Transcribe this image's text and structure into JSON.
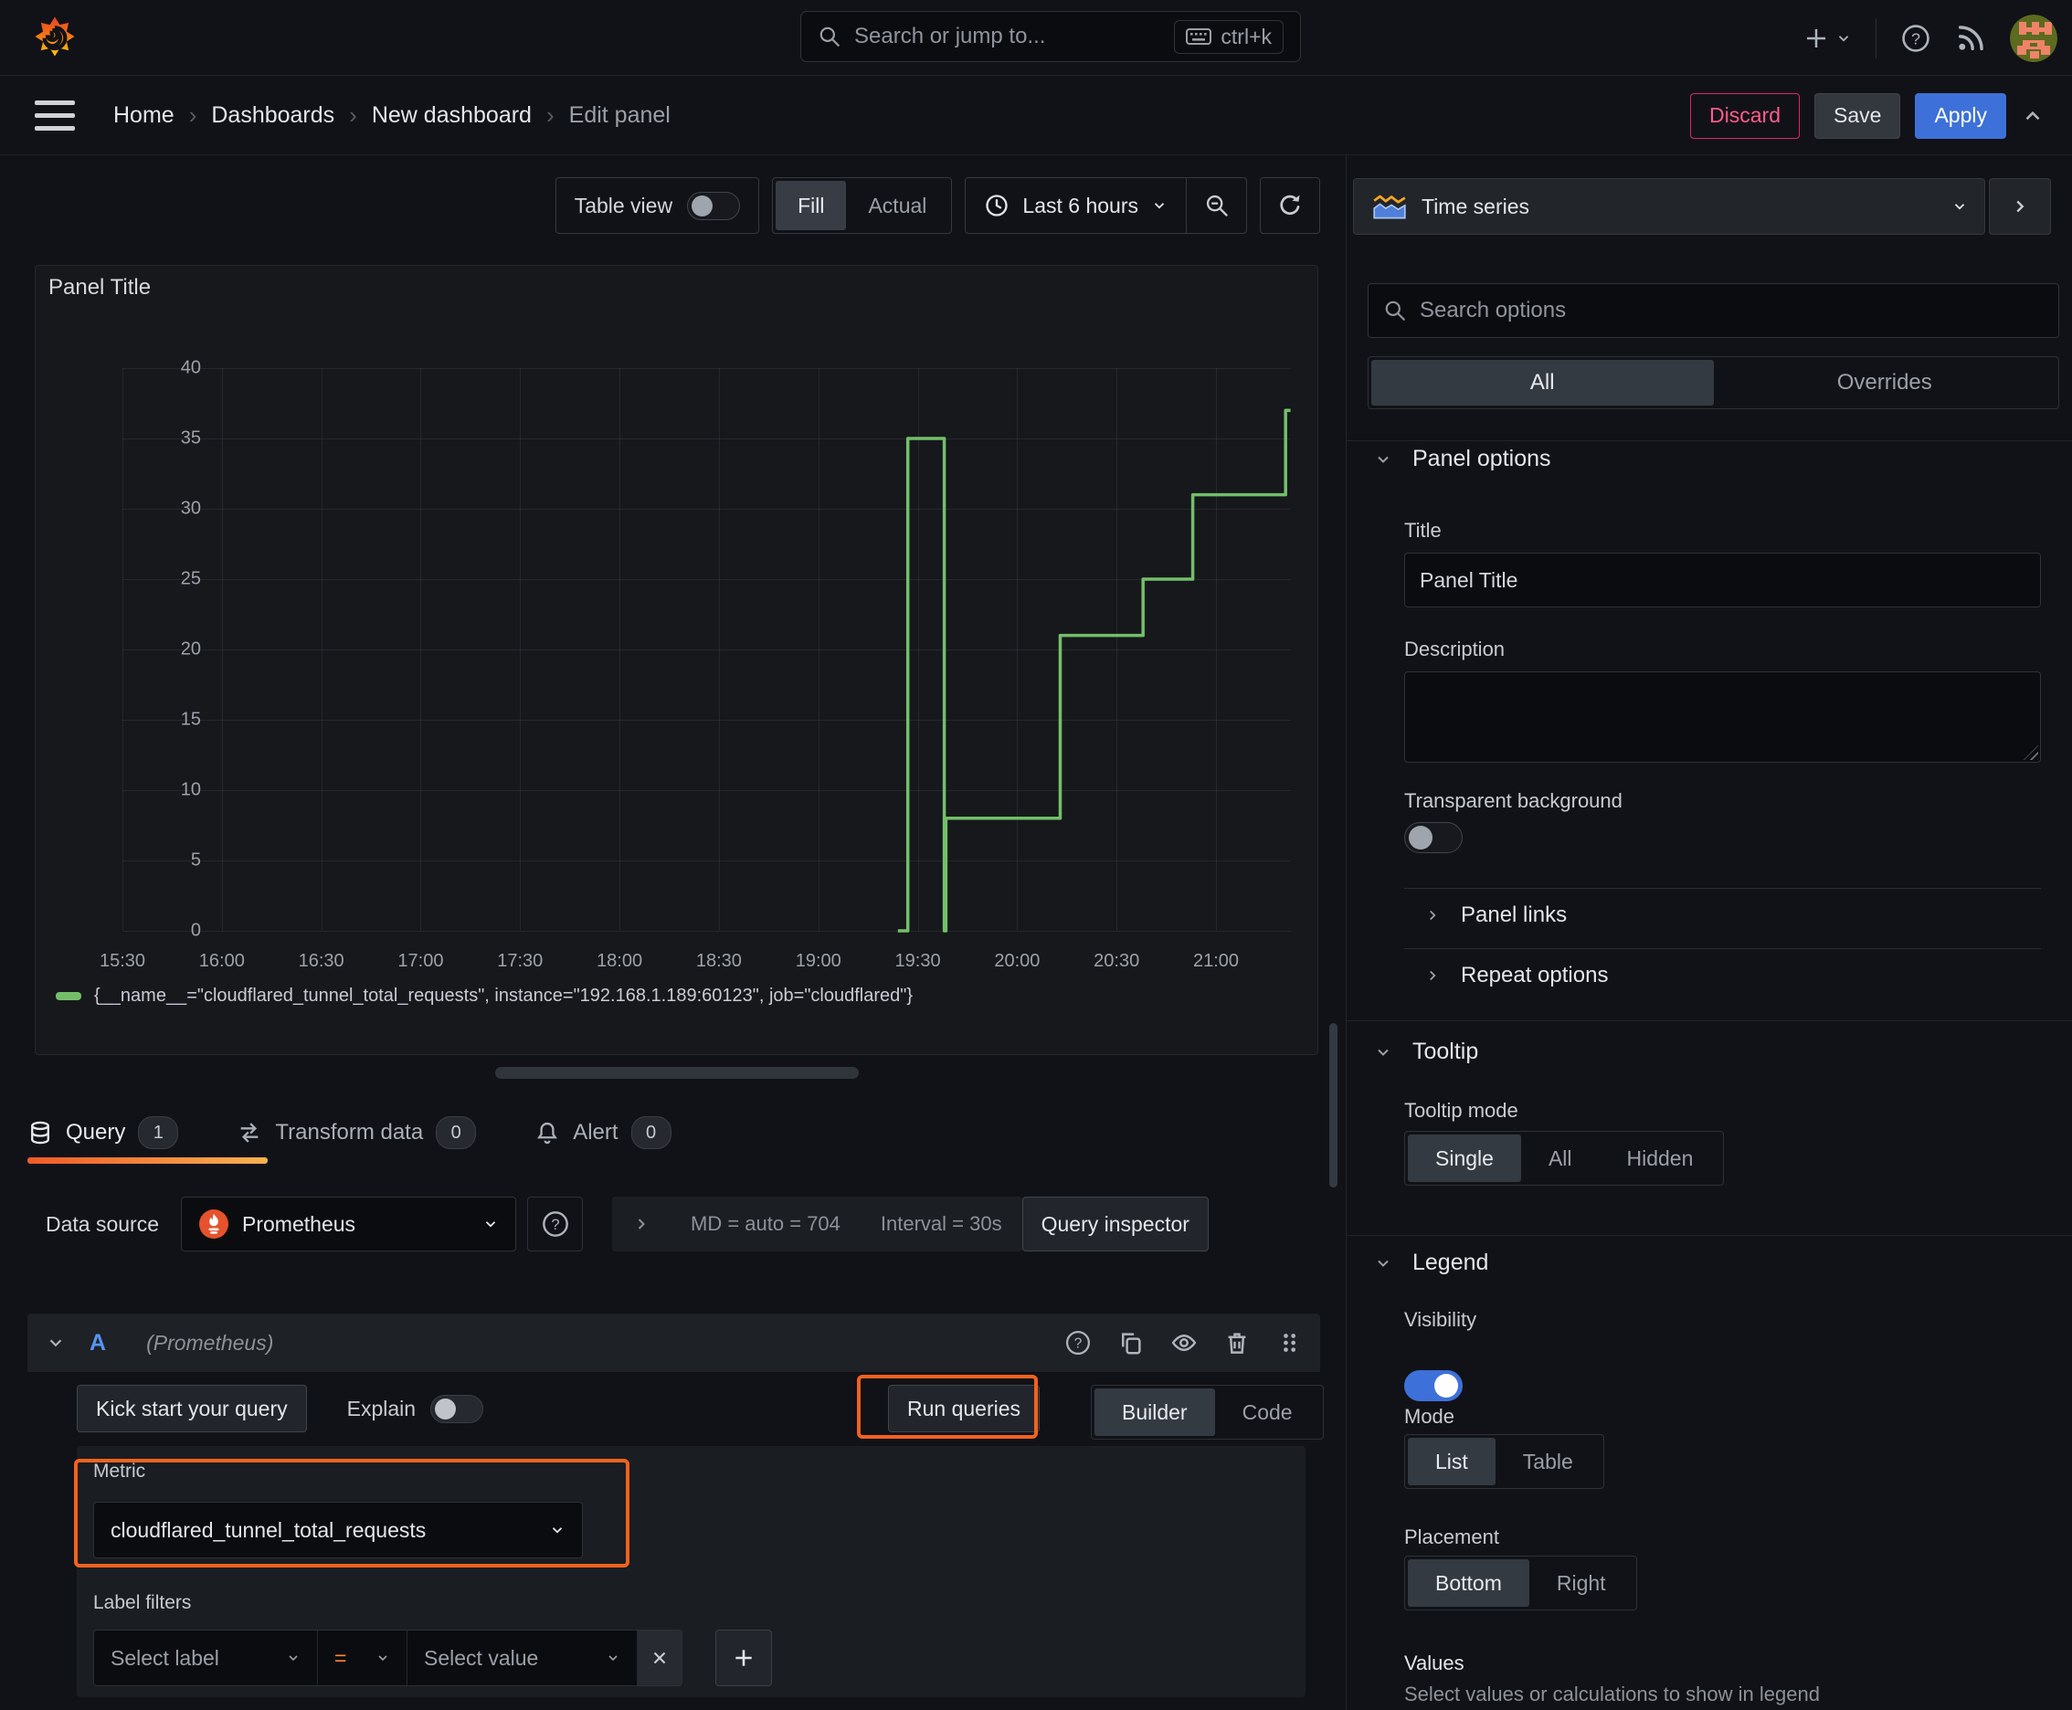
{
  "topnav": {
    "search_placeholder": "Search or jump to...",
    "shortcut": "ctrl+k"
  },
  "breadcrumb": [
    "Home",
    "Dashboards",
    "New dashboard",
    "Edit panel"
  ],
  "actions": {
    "discard": "Discard",
    "save": "Save",
    "apply": "Apply"
  },
  "toolbar": {
    "table_view_label": "Table view",
    "display_modes": [
      "Fill",
      "Actual"
    ],
    "display_mode_selected": "Fill",
    "time_range": "Last 6 hours"
  },
  "viz_picker": {
    "label": "Time series"
  },
  "panel": {
    "title": "Panel Title"
  },
  "chart_data": {
    "type": "line",
    "line_style": "step-after",
    "color": "#73bf69",
    "x_ticks": [
      "15:30",
      "16:00",
      "16:30",
      "17:00",
      "17:30",
      "18:00",
      "18:30",
      "19:00",
      "19:30",
      "20:00",
      "20:30",
      "21:00"
    ],
    "x_tick_interval_minutes": 30,
    "x_range_minutes": [
      0,
      352.6
    ],
    "y_ticks": [
      0,
      5,
      10,
      15,
      20,
      25,
      30,
      35,
      40
    ],
    "ylim": [
      0,
      40
    ],
    "series": [
      {
        "name": "{__name__=\"cloudflared_tunnel_total_requests\", instance=\"192.168.1.189:60123\", job=\"cloudflared\"}",
        "points_minutes_value": [
          [
            234,
            0
          ],
          [
            237,
            35
          ],
          [
            248,
            0
          ],
          [
            248.5,
            8
          ],
          [
            283,
            21
          ],
          [
            308,
            25
          ],
          [
            323,
            31
          ],
          [
            351,
            37
          ],
          [
            352.5,
            37
          ]
        ]
      }
    ]
  },
  "tabs": [
    {
      "label": "Query",
      "badge": "1"
    },
    {
      "label": "Transform data",
      "badge": "0"
    },
    {
      "label": "Alert",
      "badge": "0"
    }
  ],
  "query": {
    "datasource_label": "Data source",
    "datasource_name": "Prometheus",
    "stats": {
      "max_data_points": "MD = auto = 704",
      "interval": "Interval = 30s"
    },
    "inspector_label": "Query inspector",
    "ref_id": "A",
    "ds_hint": "(Prometheus)",
    "kickstart_label": "Kick start your query",
    "explain_label": "Explain",
    "run_label": "Run queries",
    "editor_modes": [
      "Builder",
      "Code"
    ],
    "editor_mode_selected": "Builder",
    "metric_label": "Metric",
    "metric_value": "cloudflared_tunnel_total_requests",
    "label_filters_label": "Label filters",
    "select_label_placeholder": "Select label",
    "operator": "=",
    "select_value_placeholder": "Select value"
  },
  "options_pane": {
    "search_placeholder": "Search options",
    "filter_tabs": [
      "All",
      "Overrides"
    ],
    "filter_tab_selected": "All",
    "panel_options": {
      "heading": "Panel options",
      "title_label": "Title",
      "title_value": "Panel Title",
      "description_label": "Description",
      "transparent_label": "Transparent background",
      "transparent_on": false
    },
    "collapsed_sections": {
      "panel_links": "Panel links",
      "repeat_options": "Repeat options"
    },
    "tooltip": {
      "heading": "Tooltip",
      "mode_label": "Tooltip mode",
      "modes": [
        "Single",
        "All",
        "Hidden"
      ],
      "mode_selected": "Single"
    },
    "legend": {
      "heading": "Legend",
      "visibility_label": "Visibility",
      "visibility_on": true,
      "mode_label": "Mode",
      "modes": [
        "List",
        "Table"
      ],
      "mode_selected": "List",
      "placement_label": "Placement",
      "placements": [
        "Bottom",
        "Right"
      ],
      "placement_selected": "Bottom",
      "values_label": "Values",
      "values_hint": "Select values or calculations to show in legend"
    }
  },
  "colors": {
    "accent_orange": "#f3621e",
    "series_green": "#73bf69",
    "primary_blue": "#3d71d9",
    "discard_pink": "#e0226e",
    "tab_underline_from": "#f05a28",
    "tab_underline_to": "#f9b24f"
  }
}
